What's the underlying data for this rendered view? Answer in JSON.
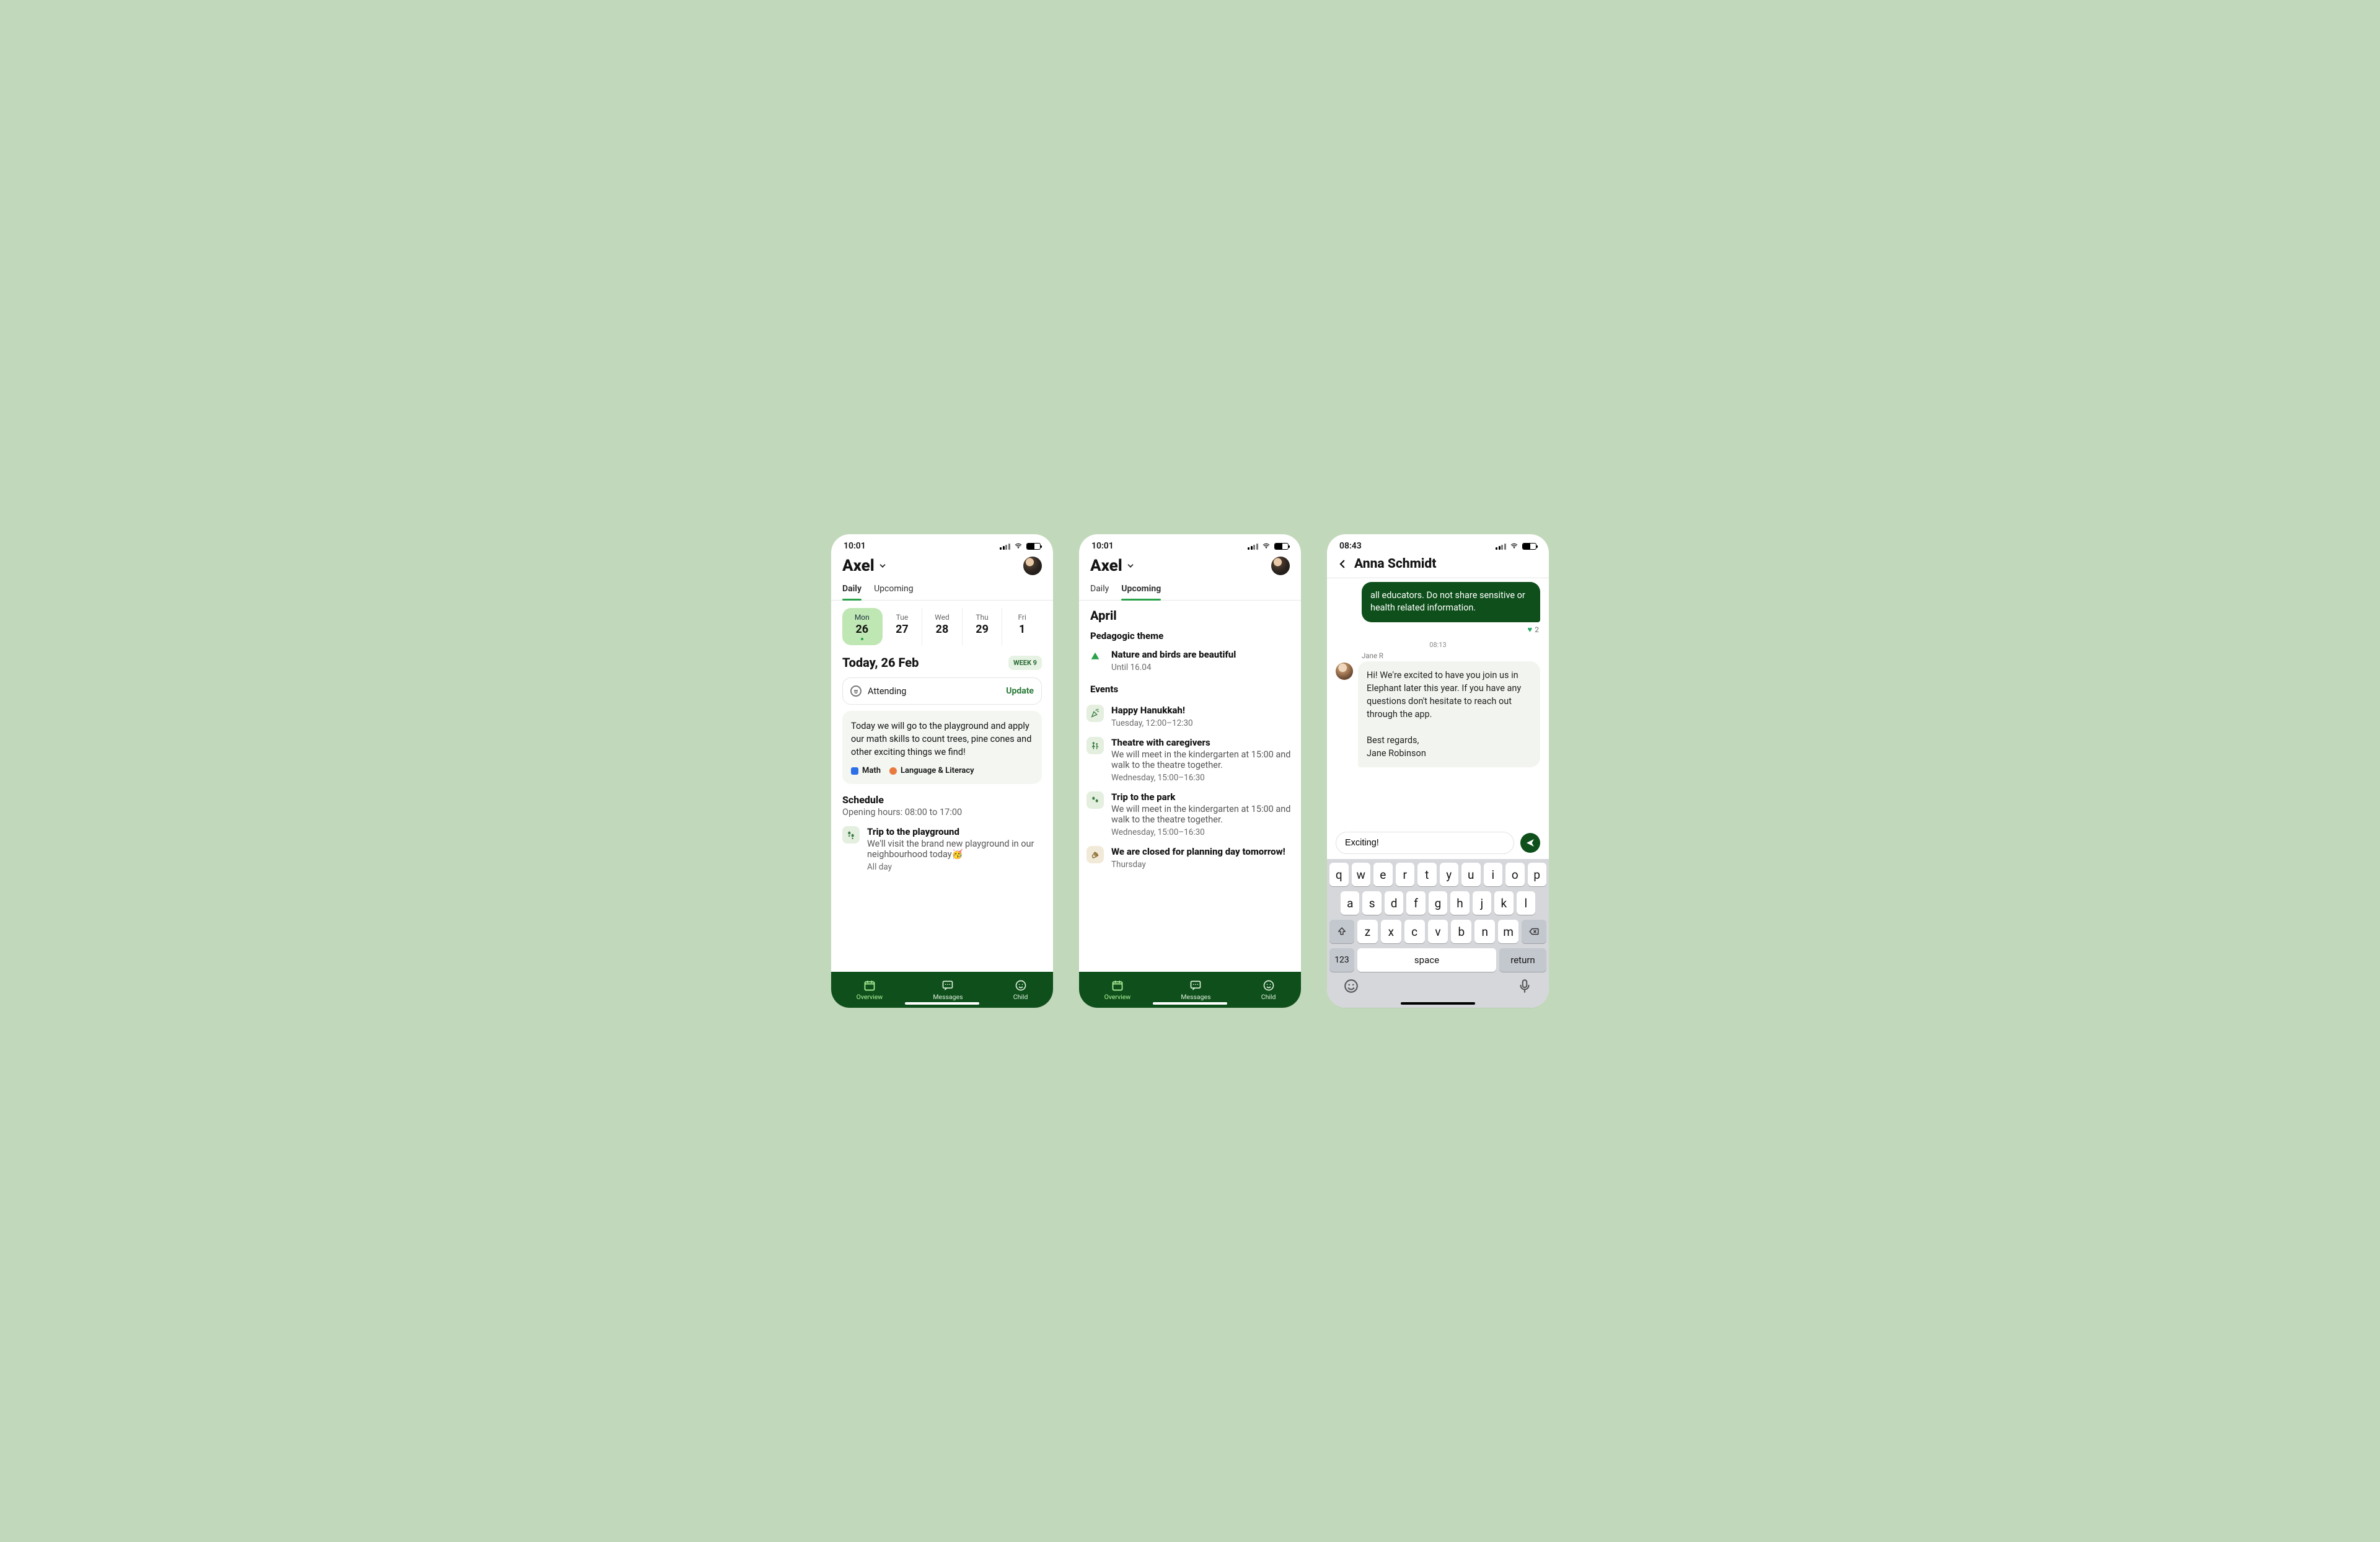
{
  "phone1": {
    "status_time": "10:01",
    "child_name": "Axel",
    "tabs": {
      "daily": "Daily",
      "upcoming": "Upcoming"
    },
    "days": [
      {
        "dow": "Mon",
        "num": "26",
        "selected": true
      },
      {
        "dow": "Tue",
        "num": "27"
      },
      {
        "dow": "Wed",
        "num": "28"
      },
      {
        "dow": "Thu",
        "num": "29"
      },
      {
        "dow": "Fri",
        "num": "1"
      }
    ],
    "today_heading": "Today, 26 Feb",
    "week_chip": "WEEK 9",
    "attendance_label": "Attending",
    "update_label": "Update",
    "note_text": "Today we will go to the playground and apply our math skills to count trees, pine cones and other exciting things we find!",
    "chip_math": "Math",
    "chip_lang": "Language & Literacy",
    "schedule_heading": "Schedule",
    "opening_hours": "Opening hours: 08:00 to 17:00",
    "trip": {
      "title": "Trip to the playground",
      "desc": "We'll visit the brand new playground in our neighbourhood today🥳",
      "meta": "All day"
    },
    "nav": {
      "overview": "Overview",
      "messages": "Messages",
      "child": "Child"
    }
  },
  "phone2": {
    "status_time": "10:01",
    "child_name": "Axel",
    "tabs": {
      "daily": "Daily",
      "upcoming": "Upcoming"
    },
    "month": "April",
    "theme_heading": "Pedagogic theme",
    "theme": {
      "title": "Nature and birds are beautiful",
      "until": "Until 16.04"
    },
    "events_heading": "Events",
    "events": [
      {
        "title": "Happy Hanukkah!",
        "meta": "Tuesday, 12:00–12:30",
        "icon": "confetti"
      },
      {
        "title": "Theatre with caregivers",
        "desc": "We will meet in the kindergarten at 15:00 and walk to the theatre together.",
        "meta": "Wednesday, 15:00–16:30",
        "icon": "people"
      },
      {
        "title": "Trip to the park",
        "desc": "We will meet in the kindergarten at 15:00 and walk to the theatre together.",
        "meta": "Wednesday, 15:00–16:30",
        "icon": "steps"
      },
      {
        "title": "We are closed for planning day tomorrow!",
        "meta": "Thursday",
        "icon": "clap",
        "beige": true
      }
    ],
    "nav": {
      "overview": "Overview",
      "messages": "Messages",
      "child": "Child"
    }
  },
  "phone3": {
    "status_time": "08:43",
    "name": "Anna Schmidt",
    "outgoing_tail": "all educators. Do not share sensitive or health related information.",
    "reaction_count": "2",
    "timestamp": "08:13",
    "sender": "Jane R",
    "incoming_body": "Hi! We're excited to have you join us in Elephant later this year. If you have any questions don't hesitate to reach out through the app.",
    "incoming_signoff": "Best regards,",
    "incoming_signature": "Jane Robinson",
    "compose_value": "Exciting!",
    "kb": {
      "row1": [
        "q",
        "w",
        "e",
        "r",
        "t",
        "y",
        "u",
        "i",
        "o",
        "p"
      ],
      "row2": [
        "a",
        "s",
        "d",
        "f",
        "g",
        "h",
        "j",
        "k",
        "l"
      ],
      "row3": [
        "z",
        "x",
        "c",
        "v",
        "b",
        "n",
        "m"
      ],
      "num": "123",
      "space": "space",
      "return": "return"
    }
  }
}
